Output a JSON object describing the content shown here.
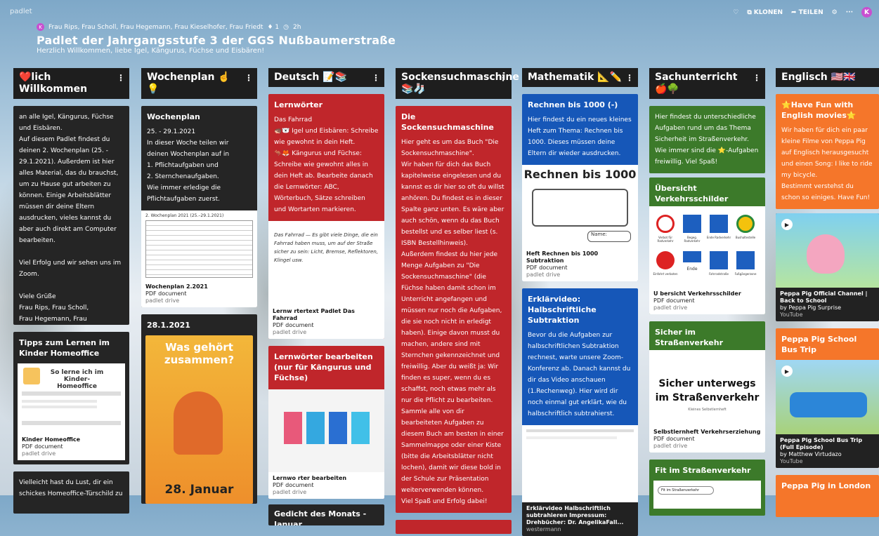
{
  "app": {
    "brand": "padlet"
  },
  "toolbar": {
    "clone_label": "KLONEN",
    "share_label": "TEILEN",
    "more_label": "···",
    "avatar_letter": "K"
  },
  "header": {
    "avatar_letter": "K",
    "authors": "Frau Rips, Frau Scholl, Frau Hegemann, Frau Kieselhofer, Frau Friedt",
    "likes": "♦ 1",
    "time": "2h",
    "title": "Padlet der Jahrgangsstufe 3 der GGS Nußbaumerstraße",
    "subtitle": "Herzlich Willkommen, liebe Igel, Kängurus, Füchse und Eisbären!"
  },
  "columns": [
    {
      "title": "❤️lich Willkommen",
      "cards": [
        {
          "title": "",
          "body": "an alle Igel, Kängurus, Füchse und Eisbären.\nAuf diesem Padlet findest du deinen 2. Wochenplan (25. - 29.1.2021). Außerdem ist hier alles Material, das du brauchst, um zu Hause gut arbeiten zu können. Einige Arbeitsblätter müssen dir deine Eltern ausdrucken, vieles kannst du aber auch direkt am Computer bearbeiten.\n\nViel Erfolg und wir sehen uns im Zoom.\n\nViele Grüße\nFrau Rips, Frau Scholl,\nFrau Hegemann, Frau Kieselhofer und Frau Friedt"
        },
        {
          "title": "Tipps zum Lernen im Kinder Homeoffice",
          "attach_name": "Kinder Homeoffice",
          "attach_type": "PDF document",
          "attach_src": "padlet drive",
          "thumb_text": "So lerne ich im Kinder-Homeoffice"
        },
        {
          "title": "",
          "body": "Vielleicht hast du Lust, dir ein schickes Homeoffice-Türschild zu"
        }
      ]
    },
    {
      "title": "Wochenplan ☝️💡",
      "cards": [
        {
          "title": "Wochenplan",
          "body": "25. - 29.1.2021\nIn dieser Woche teilen wir deinen Wochenplan auf in\n1. Pflichtaufgaben und\n2. Sternchenaufgaben.\nWie immer erledige die Pflichtaufgaben zuerst.",
          "attach_name": "Wochenplan 2.2021",
          "attach_type": "PDF document",
          "attach_src": "padlet drive",
          "thumb_text": "2. Wochenplan 2021 (25.–29.1.2021)"
        },
        {
          "title": "28.1.2021",
          "thumb_title": "Was gehört zusammen?",
          "thumb_date": "28. Januar"
        }
      ]
    },
    {
      "title": "Deutsch 📝📚",
      "cards": [
        {
          "title": "Lernwörter",
          "body": "Das Fahrrad\n🦔🐻‍❄️ Igel und Eisbären: Schreibe wie gewohnt in dein Heft.\n🦘🦊 Kängurus und Füchse: Schreibe wie gewohnt alles in dein Heft ab. Bearbeite danach die Lernwörter: ABC, Wörterbuch, Sätze schreiben und Wortarten markieren.",
          "attach_name": "Lernw rtertext Padlet Das Fahrrad",
          "attach_type": "PDF document",
          "attach_src": "padlet drive",
          "thumb_text": "Das Fahrrad — Es gibt viele Dinge, die ein Fahrrad haben muss, um auf der Straße sicher zu sein: Licht, Bremse, Reflektoren, Klingel usw."
        },
        {
          "title": "Lernwörter bearbeiten (nur für Kängurus und Füchse)",
          "attach_name": "Lernwo rter bearbeiten",
          "attach_type": "PDF document",
          "attach_src": "padlet drive"
        },
        {
          "title": "Gedicht des Monats - Januar"
        }
      ]
    },
    {
      "title": "Sockensuchmaschine 📚🧦",
      "cards": [
        {
          "title": "Die Sockensuchmaschine",
          "body": "Hier geht es um das Buch \"Die Sockensuchmaschine\".\nWir haben für dich das Buch kapitelweise eingelesen und du kannst es dir hier so oft du willst anhören. Du findest es in dieser Spalte ganz unten. Es wäre aber auch schön, wenn du das Buch bestellst und es selber liest (s. ISBN Bestellhinweis).\nAußerdem findest du hier jede Menge Aufgaben zu \"Die Sockensuchmaschine\" (die Füchse haben damit schon im Unterricht angefangen und müssen nur noch die Aufgaben, die sie noch nicht in erledigt haben). Einige davon musst du machen, andere sind mit Sternchen gekennzeichnet und freiwillig. Aber du weißt ja: Wir finden es super, wenn du es schaffst, noch etwas mehr als nur die Pflicht zu bearbeiten.\nSammle alle von dir bearbeiteten Aufgaben zu diesem Buch am besten in einer Sammelmappe oder einer Kiste (bitte die Arbeitsblätter nicht lochen), damit wir diese bold in der Schule zur Präsentation weiterverwenden können.\nViel Spaß und Erfolg dabei!"
        }
      ]
    },
    {
      "title": "Mathematik 📐✏️",
      "cards": [
        {
          "title": "Rechnen bis 1000 (-)",
          "body": "Hier findest du ein neues kleines Heft zum Thema: Rechnen bis 1000. Dieses müssen deine Eltern dir wieder ausdrucken.",
          "attach_name": "Heft Rechnen bis 1000 Subtraktion",
          "attach_type": "PDF document",
          "attach_src": "padlet drive",
          "thumb_title": "Rechnen bis 1000",
          "thumb_label": "Name:"
        },
        {
          "title": "Erklärvideo: Halbschriftliche Subtraktion",
          "body": "Bevor du die Aufgaben zur halbschriftlichen Subtraktion rechnest, warte unsere Zoom-Konferenz ab. Danach kannst du dir das Video anschauen (1.Rechenweg). Hier wird dir noch einmal gut erklärt, wie du halbschriftlich subtrahierst.",
          "attach_name": "Erklärvideo Halbschriftlich subtrahieren Impressum: Drehbücher: Dr. AngelikaFall...",
          "attach_type": "",
          "attach_src": "westermann"
        }
      ]
    },
    {
      "title": "Sachunterricht 🍎🌳",
      "cards": [
        {
          "title": "",
          "body": "Hier findest du unterschiedliche Aufgaben rund um das Thema Sicherheit im Straßenverkehr. Wie immer sind die ⭐-Aufgaben freiwillig. Viel Spaß!"
        },
        {
          "title": "Übersicht Verkehrsschilder",
          "attach_name": "U bersicht Verkehrsschilder",
          "attach_type": "PDF document",
          "attach_src": "padlet drive",
          "sign_labels": [
            "Verbot für Radverkehr",
            "Begeg. Radverkehr",
            "Ende Radverkehr",
            "Bushaltestelle",
            "Einfahrt verboten",
            "Ende",
            "Fahrradstraße",
            "Fußgängerzone"
          ]
        },
        {
          "title": "Sicher im Straßenverkehr",
          "attach_name": "Selbstlernheft Verkehrserziehung",
          "attach_type": "PDF document",
          "attach_src": "padlet drive",
          "thumb_title": "Sicher unterwegs im Straßenverkehr",
          "thumb_sub": "Kleines Selbstlernheft"
        },
        {
          "title": "Fit im Straßenverkehr",
          "thumb_text": "Fit im Straßenverkehr"
        }
      ]
    },
    {
      "title": "Englisch 🇺🇸🇬🇧",
      "cards": [
        {
          "title": "⭐Have Fun with English movies⭐",
          "body": "Wir haben für dich ein paar kleine Filme von Peppa Pig auf Englisch herausgesucht und einen Song: I like to ride my bicycle.\nBestimmt verstehst du schon so einiges. Have Fun!"
        },
        {
          "title": "",
          "attach_name": "Peppa Pig Official Channel | Back to School",
          "attach_type": "by Peppa Pig Surprise",
          "attach_src": "YouTube"
        },
        {
          "title": "Peppa Pig School Bus Trip",
          "attach_name": "Peppa Pig School Bus Trip (Full Episode)",
          "attach_type": "by Matthew Virtudazo",
          "attach_src": "YouTube"
        },
        {
          "title": "Peppa Pig in London"
        }
      ]
    }
  ],
  "colors": {
    "dark": "#252525",
    "red": "#c0262b",
    "blue": "#1657b8",
    "green": "#3c7a2a",
    "orange": "#f5762a",
    "accent": "#c84fd0"
  }
}
